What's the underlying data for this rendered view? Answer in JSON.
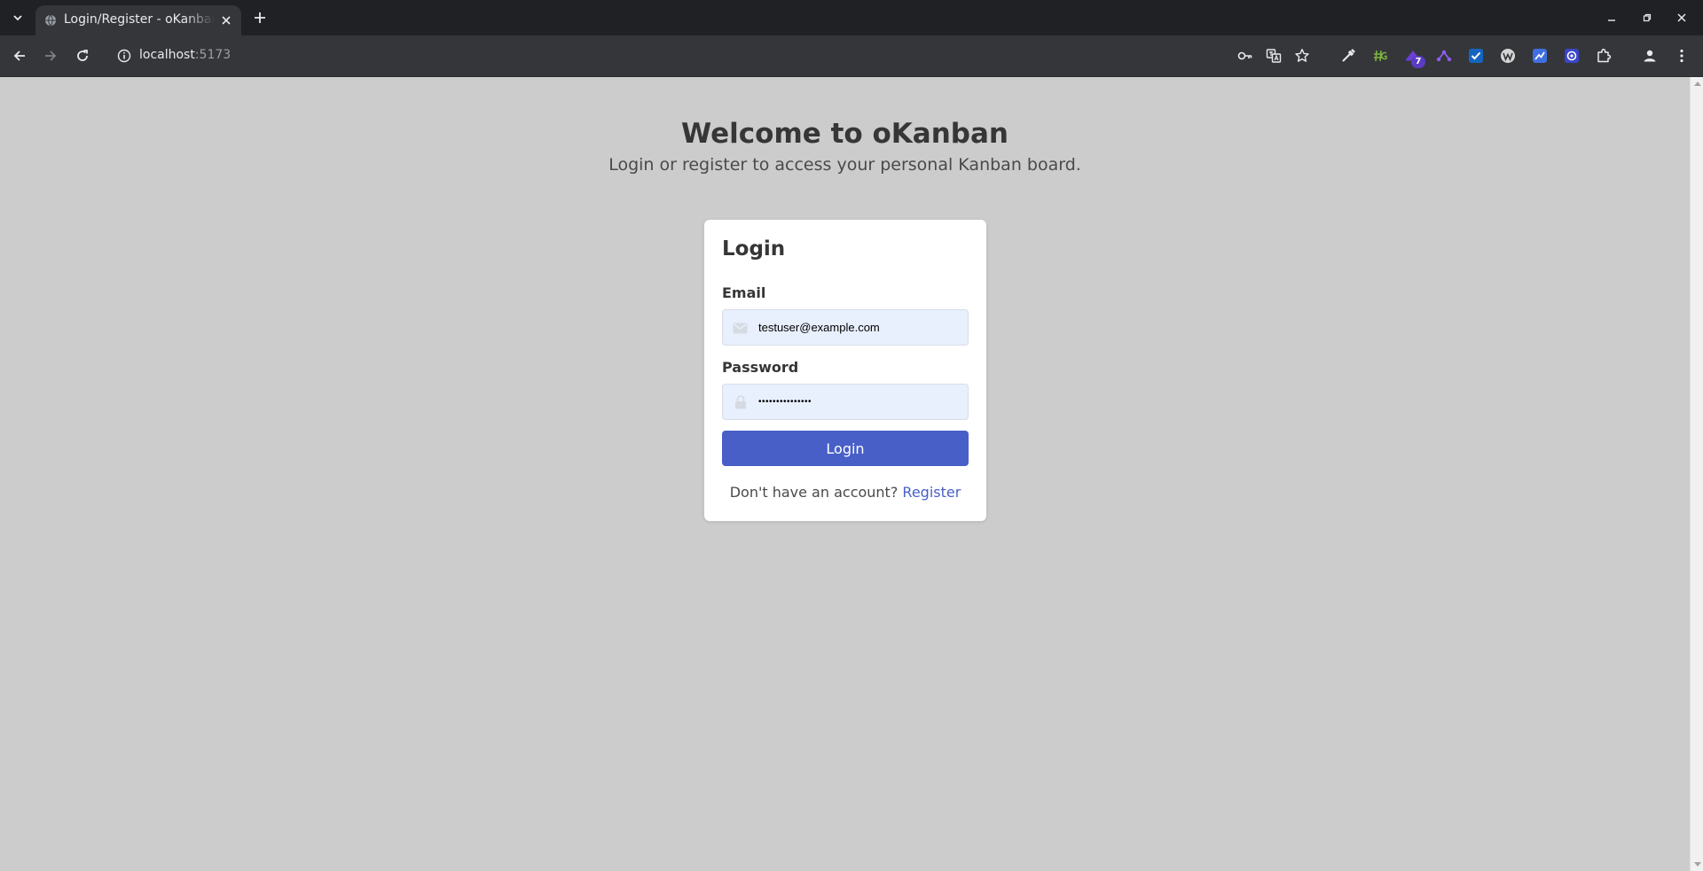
{
  "browser": {
    "tab": {
      "title": "Login/Register - oKanban"
    },
    "address_bar": {
      "host": "localhost",
      "port": ":5173"
    },
    "extensions": [
      {
        "name": "eyedropper-icon"
      },
      {
        "name": "hashtag-icon"
      },
      {
        "name": "wizard-hat-icon",
        "badge": "7"
      },
      {
        "name": "network-icon"
      },
      {
        "name": "checkmark-icon"
      },
      {
        "name": "wappalyzer-icon"
      },
      {
        "name": "chart-icon"
      },
      {
        "name": "target-icon"
      },
      {
        "name": "puzzle-icon"
      }
    ]
  },
  "page": {
    "hero": {
      "title": "Welcome to oKanban",
      "subtitle": "Login or register to access your personal Kanban board."
    },
    "login_form": {
      "title": "Login",
      "email_label": "Email",
      "email_value": "testuser@example.com",
      "password_label": "Password",
      "password_value": "testpassword123",
      "submit_label": "Login",
      "switch_prompt": "Don't have an account?",
      "switch_link": "Register"
    }
  },
  "colors": {
    "page_background": "#cccccc",
    "primary": "#485fc7",
    "autofill_background": "#e8f0fe",
    "text": "#363636"
  }
}
